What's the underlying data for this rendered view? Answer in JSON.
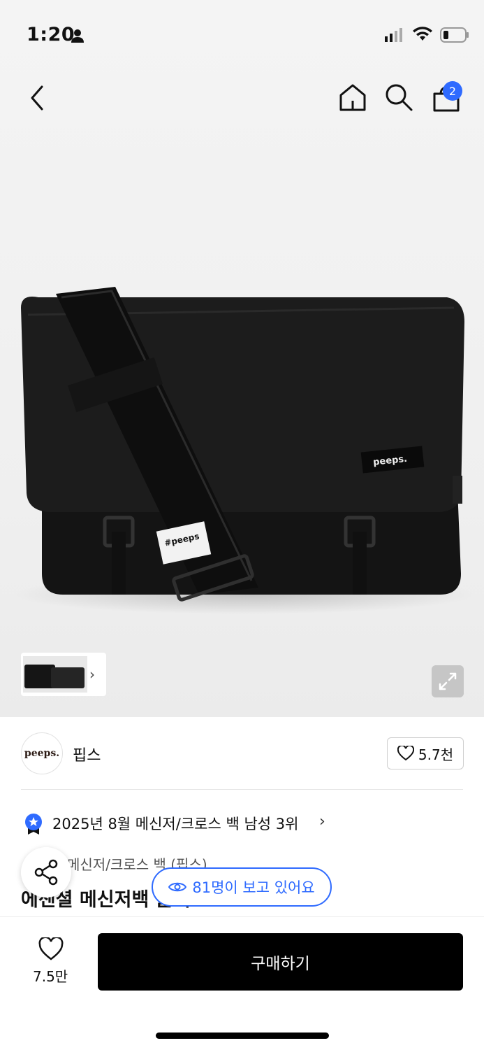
{
  "status_bar": {
    "time": "1:20"
  },
  "header": {
    "cart_count": "2"
  },
  "brand": {
    "logo_text": "peeps.",
    "name": "핍스",
    "likes": "5.7천"
  },
  "product": {
    "ranking": "2025년 8월 메신저/크로스 백 남성 3위",
    "category": "메신저/크로스 백 (핍스)",
    "title": "에센셜 메신저백 블랙"
  },
  "viewers_text": "81명이 보고 있어요",
  "bottom": {
    "wish_count": "7.5만",
    "buy_label": "구매하기"
  },
  "colors": {
    "accent": "#2f6bff",
    "buy_button": "#000000"
  }
}
